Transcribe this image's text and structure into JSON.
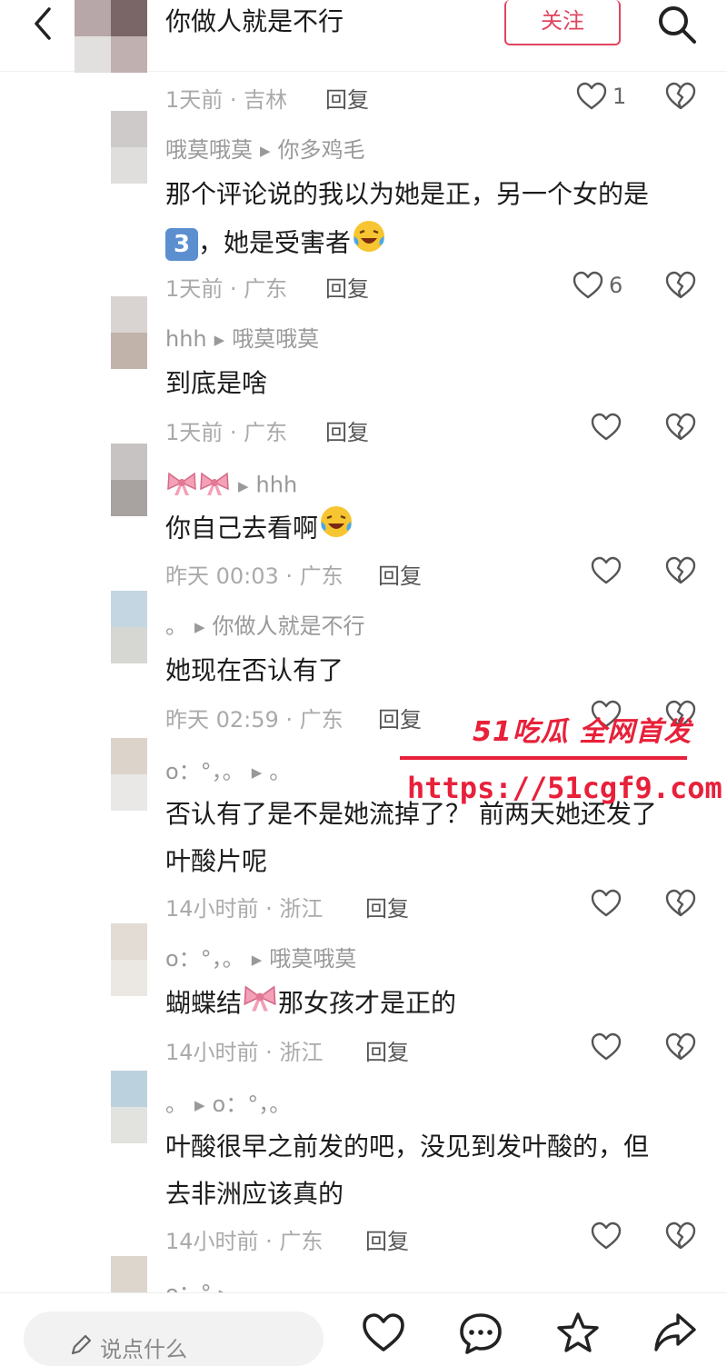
{
  "header": {
    "title": "你做人就是不行",
    "follow_label": "关注",
    "avatar_colors": [
      "#b7a7a8",
      "#7a6666",
      "#e2e0de",
      "#c0b0b0"
    ]
  },
  "comments": [
    {
      "meta": "1天前 · 吉林",
      "reply": "回复",
      "likes": "1"
    },
    {
      "user": "哦莫哦莫",
      "reply_to": "你多鸡毛",
      "text1": "那个评论说的我以为她是正，另一个女的是",
      "text2_badge": "3",
      "text2": "，她是受害者",
      "meta": "1天前 · 广东",
      "reply": "回复",
      "likes": "6",
      "avatar_colors": [
        "#cfcaca",
        "#e0dedd"
      ]
    },
    {
      "user": "hhh",
      "reply_to": "哦莫哦莫",
      "text": "到底是啥",
      "meta": "1天前 · 广东",
      "reply": "回复",
      "avatar_colors": [
        "#d9d4d2",
        "#c2b3aa"
      ]
    },
    {
      "user": "",
      "reply_to": "hhh",
      "text": "你自己去看啊",
      "meta": "昨天 00:03 · 广东",
      "reply": "回复",
      "avatar_colors": [
        "#c6c3c2",
        "#a8a3a0"
      ]
    },
    {
      "user": "。",
      "reply_to": "你做人就是不行",
      "text": "她现在否认有了",
      "meta": "昨天 02:59 · 广东",
      "reply": "回复",
      "avatar_colors": [
        "#c3d6e2",
        "#d6d6d3"
      ]
    },
    {
      "user": "o：°，。",
      "reply_to": "。",
      "text1": "否认有了是不是她流掉了？ 前两天她还发了",
      "text2": "叶酸片呢",
      "meta": "14小时前 · 浙江",
      "reply": "回复",
      "avatar_colors": [
        "#dcd4cb",
        "#eae8e6"
      ]
    },
    {
      "user": "o：°，。",
      "reply_to": "哦莫哦莫",
      "text_a": "蝴蝶结",
      "text_b": "那女孩才是正的",
      "meta": "14小时前 · 浙江",
      "reply": "回复",
      "avatar_colors": [
        "#e2dcd5",
        "#ebe8e4"
      ]
    },
    {
      "user": "。",
      "reply_to": "o：°，。",
      "text1": "叶酸很早之前发的吧，没见到发叶酸的，但",
      "text2": "去非洲应该真的",
      "meta": "14小时前 · 广东",
      "reply": "回复",
      "avatar_colors": [
        "#bcd1de",
        "#e2e2df"
      ]
    },
    {
      "user": "o：°",
      "avatar_colors": [
        "#ddd6cc",
        "#ece9e5"
      ]
    }
  ],
  "watermark": {
    "line1": "51吃瓜 全网首发",
    "line2": "https://51cgf9.com"
  },
  "bottom": {
    "input_placeholder": "说点什么"
  },
  "colors": {
    "accent": "#e0455e",
    "watermark": "#e8203a"
  }
}
